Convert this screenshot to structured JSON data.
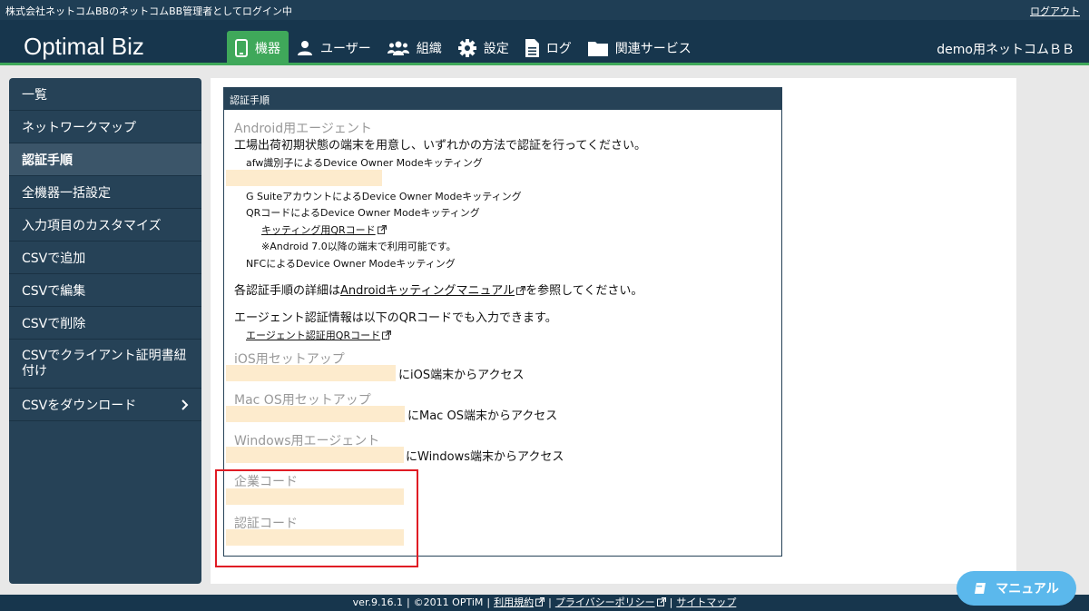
{
  "topbar": {
    "login_status": "株式会社ネットコムBBのネットコムBB管理者としてログイン中",
    "logout": "ログアウト"
  },
  "header": {
    "logo": "Optimal Biz",
    "user_name": "demo用ネットコムＢＢ",
    "nav": [
      {
        "label": "機器",
        "icon": "smartphone-icon",
        "active": true
      },
      {
        "label": "ユーザー",
        "icon": "user-icon"
      },
      {
        "label": "組織",
        "icon": "group-icon"
      },
      {
        "label": "設定",
        "icon": "gear-icon"
      },
      {
        "label": "ログ",
        "icon": "document-icon"
      },
      {
        "label": "関連サービス",
        "icon": "folder-icon"
      }
    ]
  },
  "sidebar": {
    "items": [
      {
        "label": "一覧"
      },
      {
        "label": "ネットワークマップ"
      },
      {
        "label": "認証手順",
        "active": true
      },
      {
        "label": "全機器一括設定"
      },
      {
        "label": "入力項目のカスタマイズ"
      },
      {
        "label": "CSVで追加"
      },
      {
        "label": "CSVで編集"
      },
      {
        "label": "CSVで削除"
      },
      {
        "label": "CSVでクライアント証明書紐付け"
      },
      {
        "label": "CSVをダウンロード",
        "chevron": "chevron-right-icon"
      }
    ]
  },
  "panel": {
    "title": "認証手順",
    "android": {
      "heading": "Android用エージェント",
      "intro": "工場出荷初期状態の端末を用意し、いずれかの方法で認証を行ってください。",
      "afw": "afw識別子によるDevice Owner Modeキッティング",
      "gsuite": "G SuiteアカウントによるDevice Owner Modeキッティング",
      "qr": "QRコードによるDevice Owner Modeキッティング",
      "qr_link": "キッティング用QRコード",
      "qr_note": "※Android 7.0以降の端末で利用可能です。",
      "nfc": "NFCによるDevice Owner Modeキッティング",
      "detail_prefix": "各認証手順の詳細は",
      "detail_link": "Androidキッティングマニュアル",
      "detail_suffix": "を参照してください。",
      "agent_info": "エージェント認証情報は以下のQRコードでも入力できます。",
      "agent_qr_link": "エージェント認証用QRコード"
    },
    "ios": {
      "heading": "iOS用セットアップ",
      "access": "にiOS端末からアクセス"
    },
    "mac": {
      "heading": "Mac OS用セットアップ",
      "access": "にMac OS端末からアクセス"
    },
    "windows": {
      "heading": "Windows用エージェント",
      "access": "にWindows端末からアクセス"
    },
    "company_code": {
      "heading": "企業コード"
    },
    "auth_code": {
      "heading": "認証コード"
    }
  },
  "footer": {
    "version": "ver.9.16.1",
    "copyright": "©2011 OPTiM",
    "terms": "利用規約",
    "privacy": "プライバシーポリシー",
    "sitemap": "サイトマップ"
  },
  "manual_button": {
    "label": "マニュアル",
    "icon": "book-icon"
  },
  "colors": {
    "header_bg": "#17364d",
    "accent_green": "#3fa85a",
    "sidebar_bg": "#264257",
    "highlight": "#fdebcd",
    "annotation_red": "#e01b24",
    "manual_blue": "#5bb8ec"
  }
}
